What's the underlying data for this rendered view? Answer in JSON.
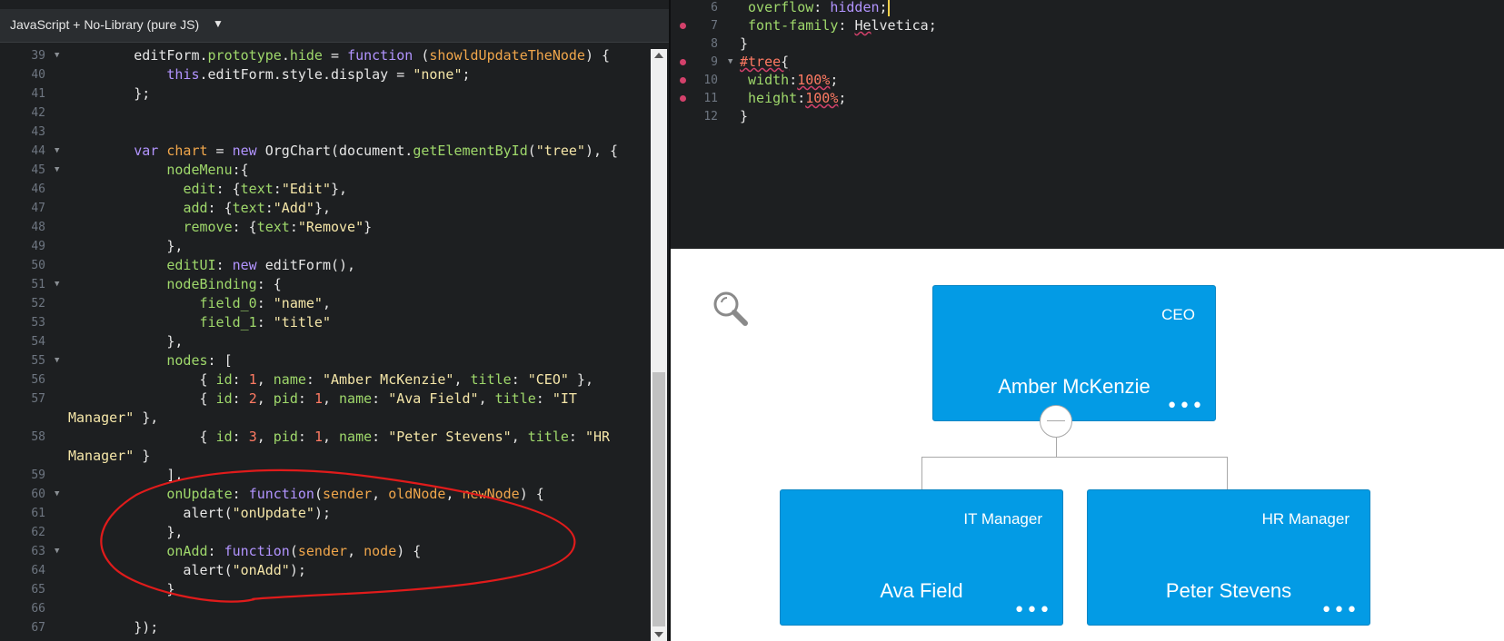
{
  "js_panel": {
    "language_label": "JavaScript + No-Library (pure JS)",
    "lines": [
      {
        "n": "39",
        "fold": true,
        "tokens": [
          [
            "plain",
            "        editForm."
          ],
          [
            "prop",
            "prototype"
          ],
          [
            "plain",
            "."
          ],
          [
            "prop",
            "hide"
          ],
          [
            "plain",
            " = "
          ],
          [
            "kw",
            "function"
          ],
          [
            "plain",
            " ("
          ],
          [
            "var",
            "showldUpdateTheNode"
          ],
          [
            "plain",
            ") {"
          ]
        ]
      },
      {
        "n": "40",
        "fold": false,
        "tokens": [
          [
            "plain",
            "            "
          ],
          [
            "this",
            "this"
          ],
          [
            "plain",
            ".editForm.style.display = "
          ],
          [
            "str",
            "\"none\""
          ],
          [
            "plain",
            ";"
          ]
        ]
      },
      {
        "n": "41",
        "fold": false,
        "tokens": [
          [
            "plain",
            "        };"
          ]
        ]
      },
      {
        "n": "42",
        "fold": false,
        "tokens": []
      },
      {
        "n": "43",
        "fold": false,
        "tokens": []
      },
      {
        "n": "44",
        "fold": true,
        "tokens": [
          [
            "plain",
            "        "
          ],
          [
            "kw",
            "var"
          ],
          [
            "plain",
            " "
          ],
          [
            "var",
            "chart"
          ],
          [
            "plain",
            " = "
          ],
          [
            "kw",
            "new"
          ],
          [
            "plain",
            " OrgChart(document."
          ],
          [
            "fn",
            "getElementById"
          ],
          [
            "plain",
            "("
          ],
          [
            "str",
            "\"tree\""
          ],
          [
            "plain",
            "), {"
          ]
        ]
      },
      {
        "n": "45",
        "fold": true,
        "tokens": [
          [
            "plain",
            "            "
          ],
          [
            "prop",
            "nodeMenu"
          ],
          [
            "plain",
            ":{"
          ]
        ]
      },
      {
        "n": "46",
        "fold": false,
        "tokens": [
          [
            "plain",
            "              "
          ],
          [
            "prop",
            "edit"
          ],
          [
            "plain",
            ": {"
          ],
          [
            "prop",
            "text"
          ],
          [
            "plain",
            ":"
          ],
          [
            "str",
            "\"Edit\""
          ],
          [
            "plain",
            "},"
          ]
        ]
      },
      {
        "n": "47",
        "fold": false,
        "tokens": [
          [
            "plain",
            "              "
          ],
          [
            "prop",
            "add"
          ],
          [
            "plain",
            ": {"
          ],
          [
            "prop",
            "text"
          ],
          [
            "plain",
            ":"
          ],
          [
            "str",
            "\"Add\""
          ],
          [
            "plain",
            "},"
          ]
        ]
      },
      {
        "n": "48",
        "fold": false,
        "tokens": [
          [
            "plain",
            "              "
          ],
          [
            "prop",
            "remove"
          ],
          [
            "plain",
            ": {"
          ],
          [
            "prop",
            "text"
          ],
          [
            "plain",
            ":"
          ],
          [
            "str",
            "\"Remove\""
          ],
          [
            "plain",
            "}"
          ]
        ]
      },
      {
        "n": "49",
        "fold": false,
        "tokens": [
          [
            "plain",
            "            },"
          ]
        ]
      },
      {
        "n": "50",
        "fold": false,
        "tokens": [
          [
            "plain",
            "            "
          ],
          [
            "prop",
            "editUI"
          ],
          [
            "plain",
            ": "
          ],
          [
            "kw",
            "new"
          ],
          [
            "plain",
            " editForm(),"
          ]
        ]
      },
      {
        "n": "51",
        "fold": true,
        "tokens": [
          [
            "plain",
            "            "
          ],
          [
            "prop",
            "nodeBinding"
          ],
          [
            "plain",
            ": {"
          ]
        ]
      },
      {
        "n": "52",
        "fold": false,
        "tokens": [
          [
            "plain",
            "                "
          ],
          [
            "prop",
            "field_0"
          ],
          [
            "plain",
            ": "
          ],
          [
            "str",
            "\"name\""
          ],
          [
            "plain",
            ","
          ]
        ]
      },
      {
        "n": "53",
        "fold": false,
        "tokens": [
          [
            "plain",
            "                "
          ],
          [
            "prop",
            "field_1"
          ],
          [
            "plain",
            ": "
          ],
          [
            "str",
            "\"title\""
          ]
        ]
      },
      {
        "n": "54",
        "fold": false,
        "tokens": [
          [
            "plain",
            "            },"
          ]
        ]
      },
      {
        "n": "55",
        "fold": true,
        "tokens": [
          [
            "plain",
            "            "
          ],
          [
            "prop",
            "nodes"
          ],
          [
            "plain",
            ": ["
          ]
        ]
      },
      {
        "n": "56",
        "fold": false,
        "tokens": [
          [
            "plain",
            "                { "
          ],
          [
            "prop",
            "id"
          ],
          [
            "plain",
            ": "
          ],
          [
            "num",
            "1"
          ],
          [
            "plain",
            ", "
          ],
          [
            "prop",
            "name"
          ],
          [
            "plain",
            ": "
          ],
          [
            "str",
            "\"Amber McKenzie\""
          ],
          [
            "plain",
            ", "
          ],
          [
            "prop",
            "title"
          ],
          [
            "plain",
            ": "
          ],
          [
            "str",
            "\"CEO\""
          ],
          [
            "plain",
            " },"
          ]
        ]
      },
      {
        "n": "57",
        "fold": false,
        "tokens": [
          [
            "plain",
            "                { "
          ],
          [
            "prop",
            "id"
          ],
          [
            "plain",
            ": "
          ],
          [
            "num",
            "2"
          ],
          [
            "plain",
            ", "
          ],
          [
            "prop",
            "pid"
          ],
          [
            "plain",
            ": "
          ],
          [
            "num",
            "1"
          ],
          [
            "plain",
            ", "
          ],
          [
            "prop",
            "name"
          ],
          [
            "plain",
            ": "
          ],
          [
            "str",
            "\"Ava Field\""
          ],
          [
            "plain",
            ", "
          ],
          [
            "prop",
            "title"
          ],
          [
            "plain",
            ": "
          ],
          [
            "str",
            "\"IT"
          ]
        ]
      },
      {
        "n": "",
        "fold": false,
        "wrap": true,
        "tokens": [
          [
            "str",
            "Manager\""
          ],
          [
            "plain",
            " },"
          ]
        ]
      },
      {
        "n": "58",
        "fold": false,
        "tokens": [
          [
            "plain",
            "                { "
          ],
          [
            "prop",
            "id"
          ],
          [
            "plain",
            ": "
          ],
          [
            "num",
            "3"
          ],
          [
            "plain",
            ", "
          ],
          [
            "prop",
            "pid"
          ],
          [
            "plain",
            ": "
          ],
          [
            "num",
            "1"
          ],
          [
            "plain",
            ", "
          ],
          [
            "prop",
            "name"
          ],
          [
            "plain",
            ": "
          ],
          [
            "str",
            "\"Peter Stevens\""
          ],
          [
            "plain",
            ", "
          ],
          [
            "prop",
            "title"
          ],
          [
            "plain",
            ": "
          ],
          [
            "str",
            "\"HR"
          ]
        ]
      },
      {
        "n": "",
        "fold": false,
        "wrap": true,
        "tokens": [
          [
            "str",
            "Manager\""
          ],
          [
            "plain",
            " }"
          ]
        ]
      },
      {
        "n": "59",
        "fold": false,
        "tokens": [
          [
            "plain",
            "            ],"
          ]
        ]
      },
      {
        "n": "60",
        "fold": true,
        "tokens": [
          [
            "plain",
            "            "
          ],
          [
            "prop",
            "onUpdate"
          ],
          [
            "plain",
            ": "
          ],
          [
            "kw",
            "function"
          ],
          [
            "plain",
            "("
          ],
          [
            "var",
            "sender"
          ],
          [
            "plain",
            ", "
          ],
          [
            "var",
            "oldNode"
          ],
          [
            "plain",
            ", "
          ],
          [
            "var",
            "newNode"
          ],
          [
            "plain",
            ") {"
          ]
        ]
      },
      {
        "n": "61",
        "fold": false,
        "tokens": [
          [
            "plain",
            "              alert("
          ],
          [
            "str",
            "\"onUpdate\""
          ],
          [
            "plain",
            ");"
          ]
        ]
      },
      {
        "n": "62",
        "fold": false,
        "tokens": [
          [
            "plain",
            "            },"
          ]
        ]
      },
      {
        "n": "63",
        "fold": true,
        "tokens": [
          [
            "plain",
            "            "
          ],
          [
            "prop",
            "onAdd"
          ],
          [
            "plain",
            ": "
          ],
          [
            "kw",
            "function"
          ],
          [
            "plain",
            "("
          ],
          [
            "var",
            "sender"
          ],
          [
            "plain",
            ", "
          ],
          [
            "var",
            "node"
          ],
          [
            "plain",
            ") {"
          ]
        ]
      },
      {
        "n": "64",
        "fold": false,
        "tokens": [
          [
            "plain",
            "              alert("
          ],
          [
            "str",
            "\"onAdd\""
          ],
          [
            "plain",
            ");"
          ]
        ]
      },
      {
        "n": "65",
        "fold": false,
        "tokens": [
          [
            "plain",
            "            }"
          ]
        ]
      },
      {
        "n": "66",
        "fold": false,
        "tokens": []
      },
      {
        "n": "67",
        "fold": false,
        "tokens": [
          [
            "plain",
            "        });"
          ]
        ]
      }
    ]
  },
  "css_panel": {
    "lines": [
      {
        "n": "6",
        "marker": false,
        "fold": false,
        "parts": [
          [
            "plain",
            " "
          ],
          [
            "prop",
            "overflow"
          ],
          [
            "plain",
            ": "
          ],
          [
            "val",
            "hidden"
          ],
          [
            "plain",
            ";"
          ]
        ],
        "cursor": true
      },
      {
        "n": "7",
        "marker": true,
        "fold": false,
        "parts": [
          [
            "plain",
            " "
          ],
          [
            "prop",
            "font-family"
          ],
          [
            "plain",
            ": "
          ],
          [
            "squig",
            "He"
          ],
          [
            "plain",
            "lvetica;"
          ]
        ]
      },
      {
        "n": "8",
        "marker": false,
        "fold": false,
        "parts": [
          [
            "plain",
            "}"
          ]
        ]
      },
      {
        "n": "9",
        "marker": true,
        "fold": true,
        "parts": [
          [
            "sel",
            "#tree"
          ],
          [
            "squig",
            "{"
          ]
        ]
      },
      {
        "n": "10",
        "marker": true,
        "fold": false,
        "parts": [
          [
            "plain",
            " "
          ],
          [
            "prop",
            "width"
          ],
          [
            "plain",
            ":"
          ],
          [
            "num",
            "100%"
          ],
          [
            "plain",
            ";"
          ]
        ]
      },
      {
        "n": "11",
        "marker": true,
        "fold": false,
        "parts": [
          [
            "plain",
            " "
          ],
          [
            "prop",
            "height"
          ],
          [
            "plain",
            ":"
          ],
          [
            "num",
            "100%"
          ],
          [
            "plain",
            ";"
          ]
        ]
      },
      {
        "n": "12",
        "marker": false,
        "fold": false,
        "parts": [
          [
            "plain",
            "}"
          ]
        ]
      }
    ]
  },
  "org_chart": {
    "root": {
      "title": "CEO",
      "name": "Amber McKenzie",
      "menu": "•••"
    },
    "children": [
      {
        "title": "IT Manager",
        "name": "Ava Field",
        "menu": "•••"
      },
      {
        "title": "HR Manager",
        "name": "Peter Stevens",
        "menu": "•••"
      }
    ],
    "node_color": "#039be5",
    "link_color": "#a8a8a8"
  }
}
